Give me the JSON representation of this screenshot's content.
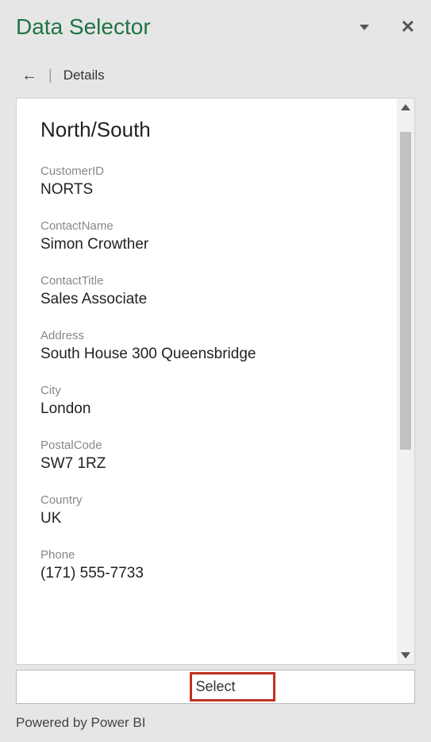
{
  "header": {
    "title": "Data Selector"
  },
  "breadcrumb": {
    "label": "Details"
  },
  "record": {
    "title": "North/South",
    "fields": [
      {
        "label": "CustomerID",
        "value": "NORTS"
      },
      {
        "label": "ContactName",
        "value": "Simon Crowther"
      },
      {
        "label": "ContactTitle",
        "value": "Sales Associate"
      },
      {
        "label": "Address",
        "value": "South House 300 Queensbridge"
      },
      {
        "label": "City",
        "value": "London"
      },
      {
        "label": "PostalCode",
        "value": "SW7 1RZ"
      },
      {
        "label": "Country",
        "value": "UK"
      },
      {
        "label": "Phone",
        "value": "(171) 555-7733"
      }
    ]
  },
  "actions": {
    "select_label": "Select"
  },
  "footer": {
    "text": "Powered by Power BI"
  }
}
